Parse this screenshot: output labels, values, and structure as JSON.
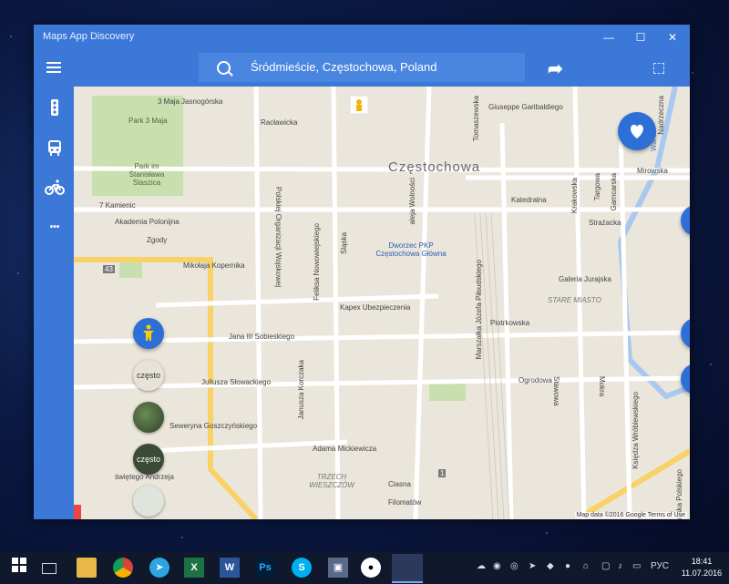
{
  "window": {
    "title": "Maps App Discovery",
    "controls": [
      "—",
      "☐",
      "✕"
    ]
  },
  "search": {
    "value": "Śródmieście, Częstochowa, Poland"
  },
  "sidebar": {
    "more_label": "•••"
  },
  "map": {
    "city_label": "Częstochowa",
    "district_labels": [
      "STARE MIASTO",
      "TRZECH WIESZCZÓW"
    ],
    "streets": [
      "3 Maja",
      "Jasnogórska",
      "Racławicka",
      "Park 3 Maja",
      "Park im Stanisława Staszica",
      "7 Kamienic",
      "Akademia Polonijna",
      "Zgody",
      "Mikołaja Kopernika",
      "Polskiej Organizacji Wojskowej",
      "Feliksa Nowowiejskiego",
      "Śląska",
      "aleja Wolności",
      "Dworzec PKP Częstochowa Główna",
      "Marszałka Józefa Piłsudskiego",
      "Tomaszewska",
      "Giuseppe Garibaldiego",
      "Katedralna",
      "Krakowska",
      "Targowa",
      "Garncarska",
      "Strażacka",
      "Mirowska",
      "Warta",
      "Nadrzeczna",
      "Galeria Jurajska",
      "Kapex Ubezpieczenia",
      "Piotrkowska",
      "Jana III Sobieskiego",
      "Janusza Korczaka",
      "Juliusza Słowackiego",
      "Seweryna Goszczyńskiego",
      "świętego Andrzeja",
      "Adama Mickiewicza",
      "Ciasna",
      "Filomatów",
      "Ogrodowa",
      "Stawowa",
      "Mokra",
      "Księdza Wróblewskiego",
      "Wojska Polskiego",
      "43",
      "1"
    ],
    "attribution": "Map data ©2016 Google   Terms of Use",
    "thumb_label": "często"
  },
  "taskbar": {
    "apps": [
      "Start",
      "Task View",
      "File Explorer",
      "Chrome",
      "Telegram",
      "Excel",
      "Word",
      "Photoshop",
      "Skype",
      "Store",
      "Panda",
      "Maps"
    ],
    "language": "РУС",
    "time": "18:41",
    "date": "11.07.2016"
  }
}
